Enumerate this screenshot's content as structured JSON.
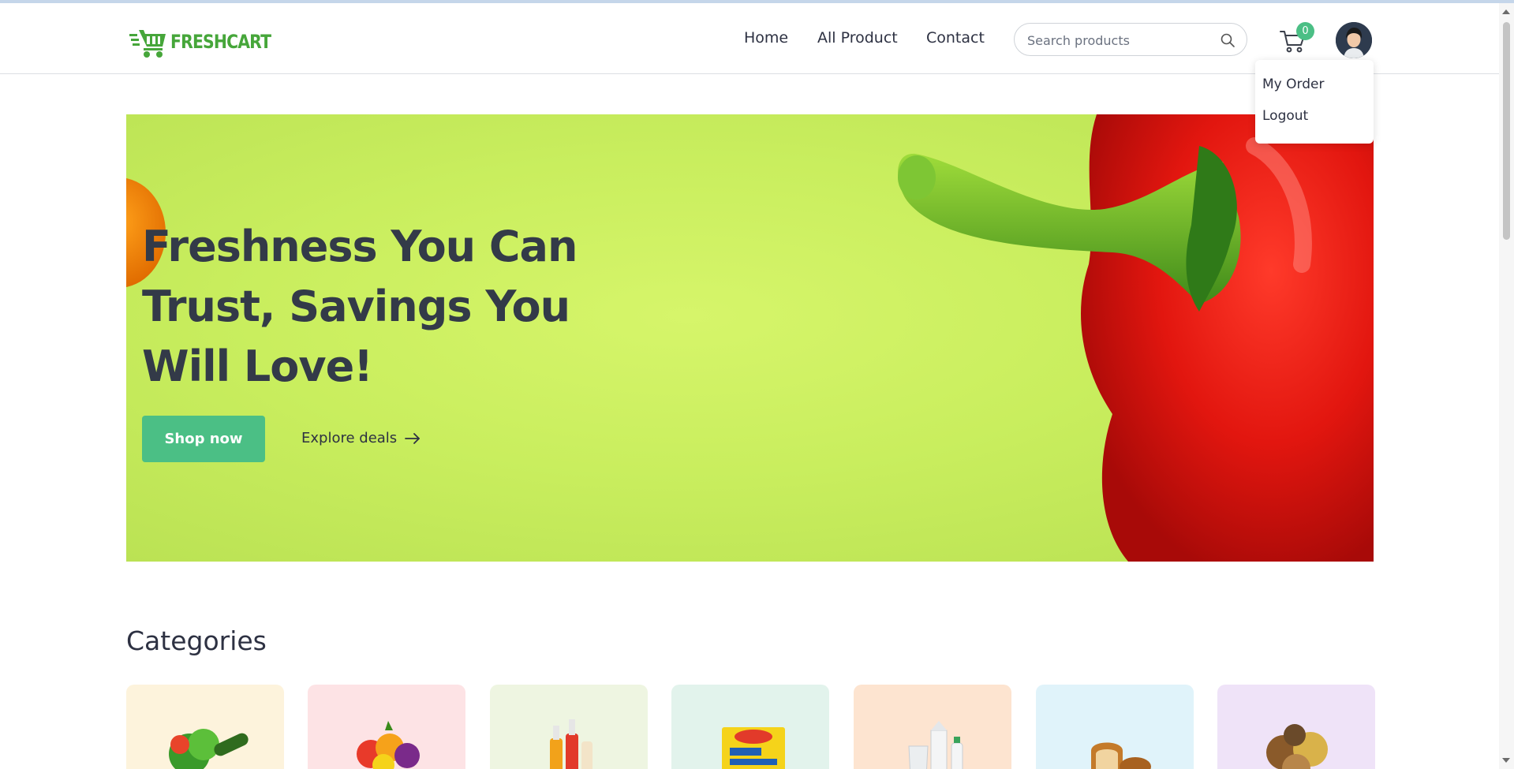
{
  "brand": {
    "name": "FRESHCART",
    "color": "#46a63a"
  },
  "nav": {
    "links": [
      "Home",
      "All Product",
      "Contact"
    ]
  },
  "search": {
    "placeholder": "Search products",
    "value": ""
  },
  "cart": {
    "count": "0"
  },
  "user_menu": {
    "items": [
      "My Order",
      "Logout"
    ]
  },
  "hero": {
    "title": "Freshness You Can Trust, Savings You Will Love!",
    "primary_button": "Shop now",
    "secondary_link": "Explore deals"
  },
  "categories": {
    "heading": "Categories",
    "cards": [
      {
        "icon": "vegetables-icon",
        "bg": "#fdf3dc"
      },
      {
        "icon": "fruits-icon",
        "bg": "#fde3e5"
      },
      {
        "icon": "beverages-icon",
        "bg": "#eef5e1"
      },
      {
        "icon": "noodles-icon",
        "bg": "#e2f3ec"
      },
      {
        "icon": "dairy-icon",
        "bg": "#fde4d0"
      },
      {
        "icon": "bakery-icon",
        "bg": "#e0f3fa"
      },
      {
        "icon": "grains-icon",
        "bg": "#efe3f8"
      }
    ]
  },
  "colors": {
    "accent": "#4bbf85",
    "text": "#2d3142",
    "hero_bg": "#c9ee5e"
  }
}
